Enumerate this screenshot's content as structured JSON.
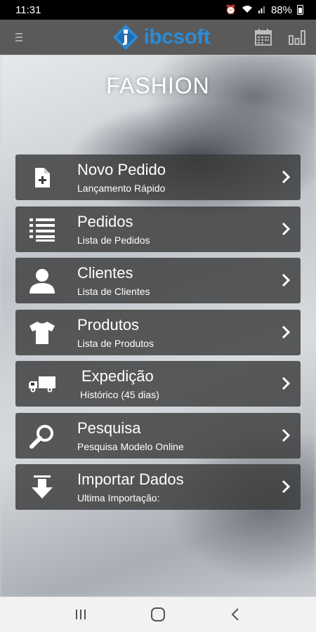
{
  "status_bar": {
    "time": "11:31",
    "battery": "88%",
    "icons": [
      "alarm-icon",
      "wifi-icon",
      "signal-icon",
      "battery-icon"
    ]
  },
  "app_bar": {
    "logo_text": "ibcsoft",
    "icons": [
      "menu-icon",
      "calendar-icon",
      "bar-chart-icon"
    ]
  },
  "page": {
    "title": "FASHION"
  },
  "menu": {
    "items": [
      {
        "title": "Novo Pedido",
        "subtitle": "Lançamento Rápido",
        "icon": "new-document-icon"
      },
      {
        "title": "Pedidos",
        "subtitle": "Lista de Pedidos",
        "icon": "list-icon"
      },
      {
        "title": "Clientes",
        "subtitle": "Lista de Clientes",
        "icon": "user-icon"
      },
      {
        "title": "Produtos",
        "subtitle": "Lista de Produtos",
        "icon": "tshirt-icon"
      },
      {
        "title": "Expedição",
        "subtitle": "Histórico (45 dias)",
        "icon": "truck-icon"
      },
      {
        "title": "Pesquisa",
        "subtitle": "Pesquisa Modelo Online",
        "icon": "search-icon"
      },
      {
        "title": "Importar Dados",
        "subtitle": "Ultima Importação:",
        "icon": "download-icon"
      }
    ]
  },
  "nav_bar": {
    "icons": [
      "recent-apps-icon",
      "home-icon",
      "back-icon"
    ]
  },
  "colors": {
    "app_bar": "#5a5a5a",
    "menu_item_bg": "#3a3a3a",
    "brand_blue": "#2b8bd6",
    "nav_bar": "#f2f2f2"
  }
}
